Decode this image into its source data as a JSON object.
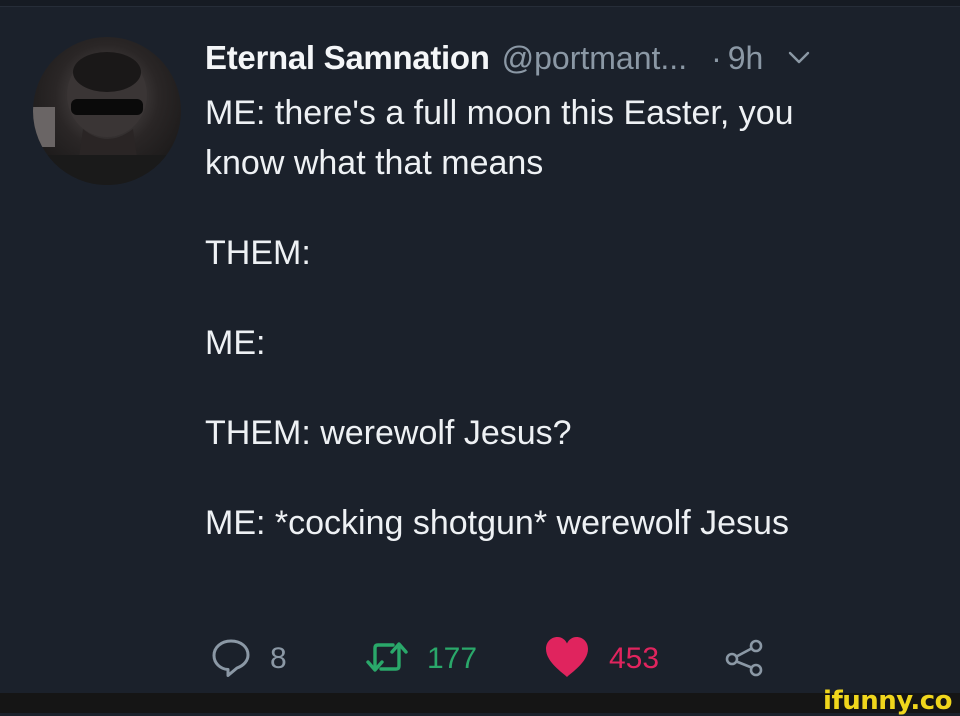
{
  "tweet": {
    "display_name": "Eternal Samnation",
    "handle": "@portmant...",
    "separator": "·",
    "time": "9h",
    "lines": [
      "ME: there's a full moon this Easter, you",
      "know what that means",
      "THEM:",
      "ME:",
      "THEM: werewolf Jesus?",
      "ME: *cocking shotgun* werewolf Jesus"
    ]
  },
  "actions": {
    "replies": "8",
    "retweets": "177",
    "likes": "453"
  },
  "watermark": "ifunny.co",
  "icons": {
    "reply": "reply-icon",
    "retweet": "retweet-icon",
    "like": "heart-icon",
    "share": "share-icon",
    "menu": "chevron-down-icon"
  },
  "colors": {
    "background": "#1b212b",
    "muted": "#8b98a5",
    "retweet": "#2aa86a",
    "like": "#e0245e",
    "watermark": "#f0d61c"
  }
}
